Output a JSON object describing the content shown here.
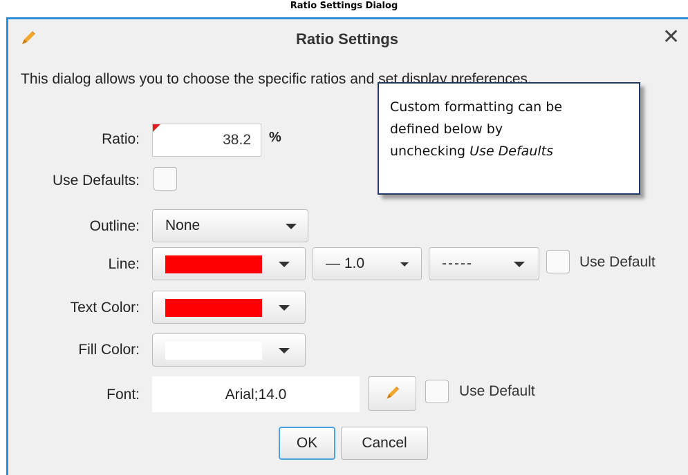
{
  "caption": "Ratio Settings Dialog",
  "dialog": {
    "title": "Ratio Settings",
    "title_icon": "pencil-icon",
    "close_glyph": "✕",
    "intro": "This dialog allows you to choose the specific ratios and set display preferences.",
    "accent_color": "#2e8fd6"
  },
  "ratio": {
    "label": "Ratio:",
    "value": "38.2",
    "unit": "%"
  },
  "use_defaults": {
    "label": "Use Defaults:",
    "checked": false
  },
  "outline": {
    "label": "Outline:",
    "selected": "None"
  },
  "line": {
    "label": "Line:",
    "color": "#ff0000",
    "width_selected": "— 1.0",
    "style_selected": "-----",
    "use_default_label": "Use Default"
  },
  "text_color": {
    "label": "Text Color:",
    "color": "#ff0000"
  },
  "fill_color": {
    "label": "Fill Color:",
    "color": "#ffffff"
  },
  "font": {
    "label": "Font:",
    "value": "Arial;14.0",
    "edit_icon": "pencil-icon",
    "use_default_label": "Use Default"
  },
  "buttons": {
    "ok": "OK",
    "cancel": "Cancel"
  },
  "tooltip": {
    "line1": "Custom formatting can be",
    "line2": "defined below by",
    "line3_prefix": "unchecking ",
    "line3_emphasis": "Use Defaults"
  }
}
